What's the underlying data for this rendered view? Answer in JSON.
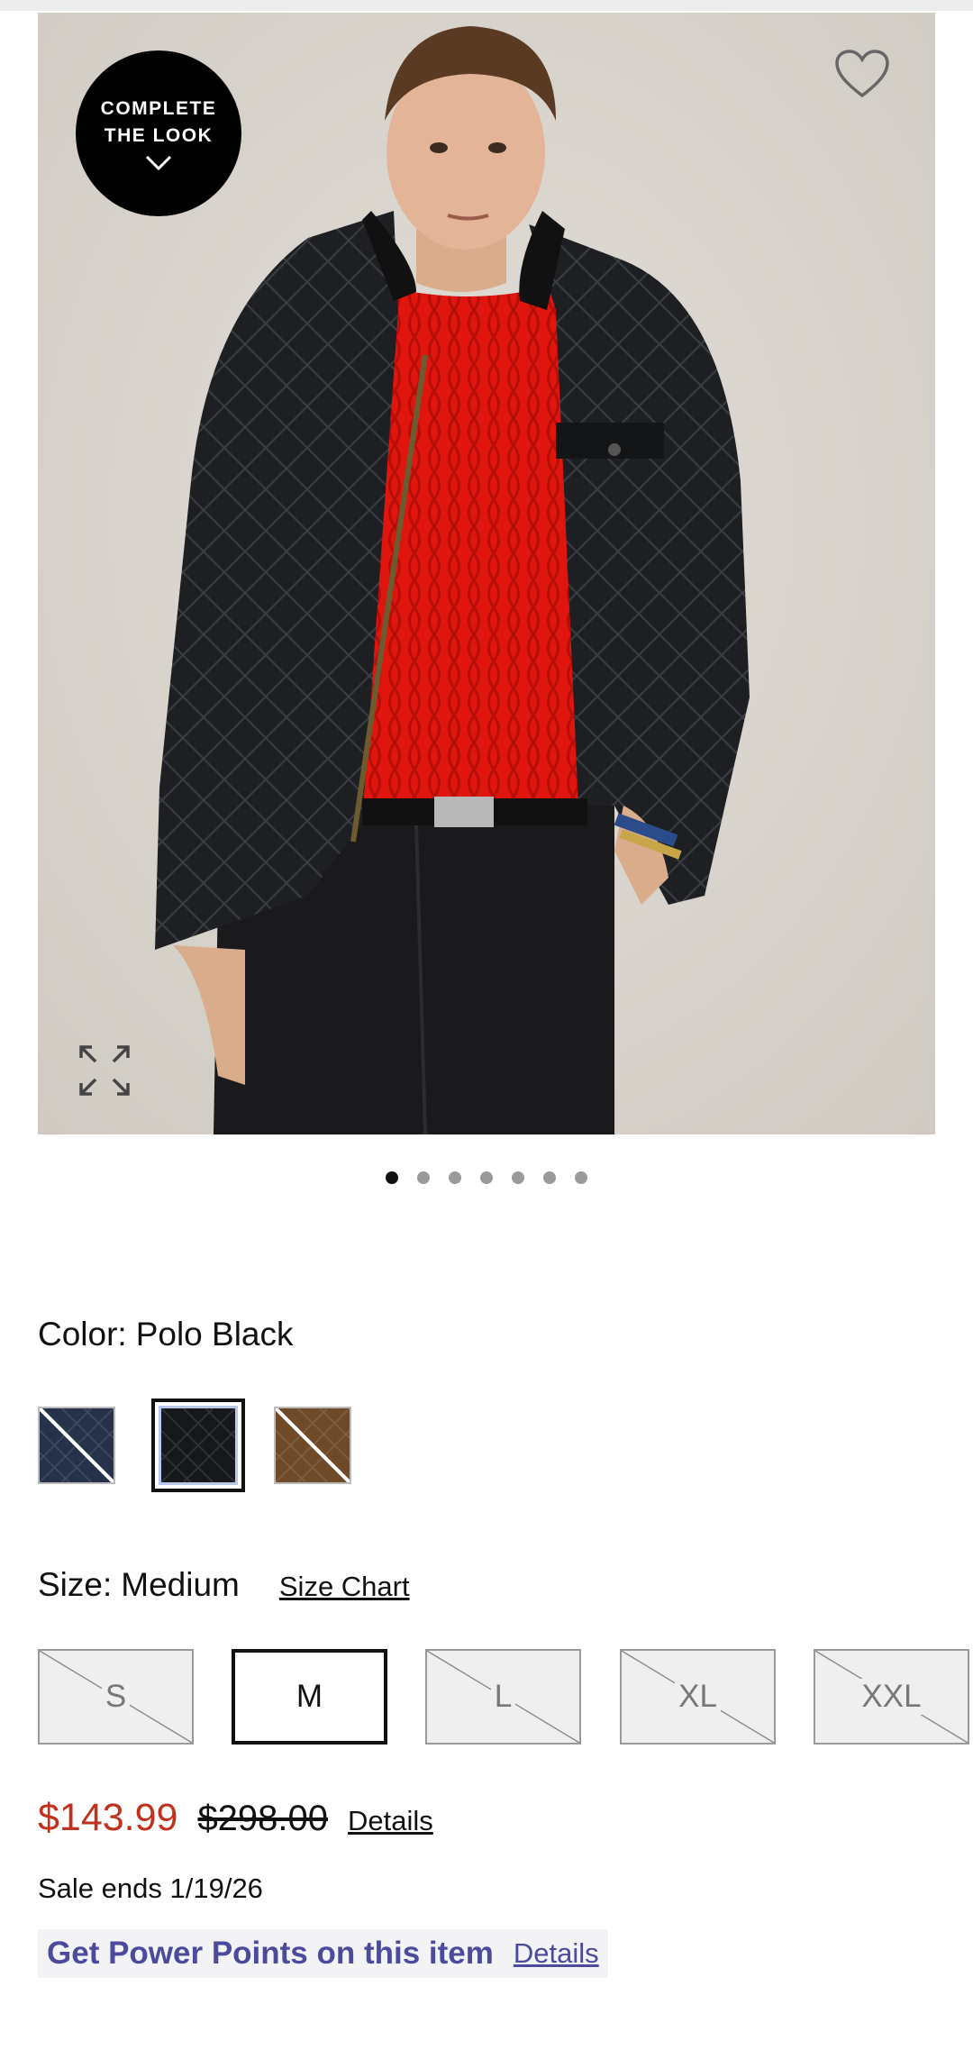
{
  "gallery": {
    "badge_line1": "COMPLETE",
    "badge_line2": "THE LOOK",
    "favorite_icon": "heart-outline-icon",
    "expand_icon": "expand-arrows-icon",
    "slide_count": 7,
    "active_slide": 1
  },
  "color": {
    "label": "Color:",
    "value": "Polo Black",
    "swatches": [
      {
        "name": "navy",
        "hex": "#26324a",
        "available": false,
        "selected": false
      },
      {
        "name": "Polo Black",
        "hex": "#16181c",
        "available": true,
        "selected": true
      },
      {
        "name": "brown",
        "hex": "#6e4a28",
        "available": false,
        "selected": false
      }
    ]
  },
  "size": {
    "label": "Size:",
    "value": "Medium",
    "chart_link": "Size Chart",
    "options": [
      {
        "label": "S",
        "available": false,
        "selected": false
      },
      {
        "label": "M",
        "available": true,
        "selected": true
      },
      {
        "label": "L",
        "available": false,
        "selected": false
      },
      {
        "label": "XL",
        "available": false,
        "selected": false
      },
      {
        "label": "XXL",
        "available": false,
        "selected": false
      }
    ]
  },
  "price": {
    "sale": "$143.99",
    "original": "$298.00",
    "details_link": "Details",
    "sale_color": "#c0321e"
  },
  "sale_ends": "Sale ends 1/19/26",
  "power_points": {
    "text": "Get Power Points on this item",
    "details_link": "Details",
    "accent": "#4b4a9c"
  }
}
